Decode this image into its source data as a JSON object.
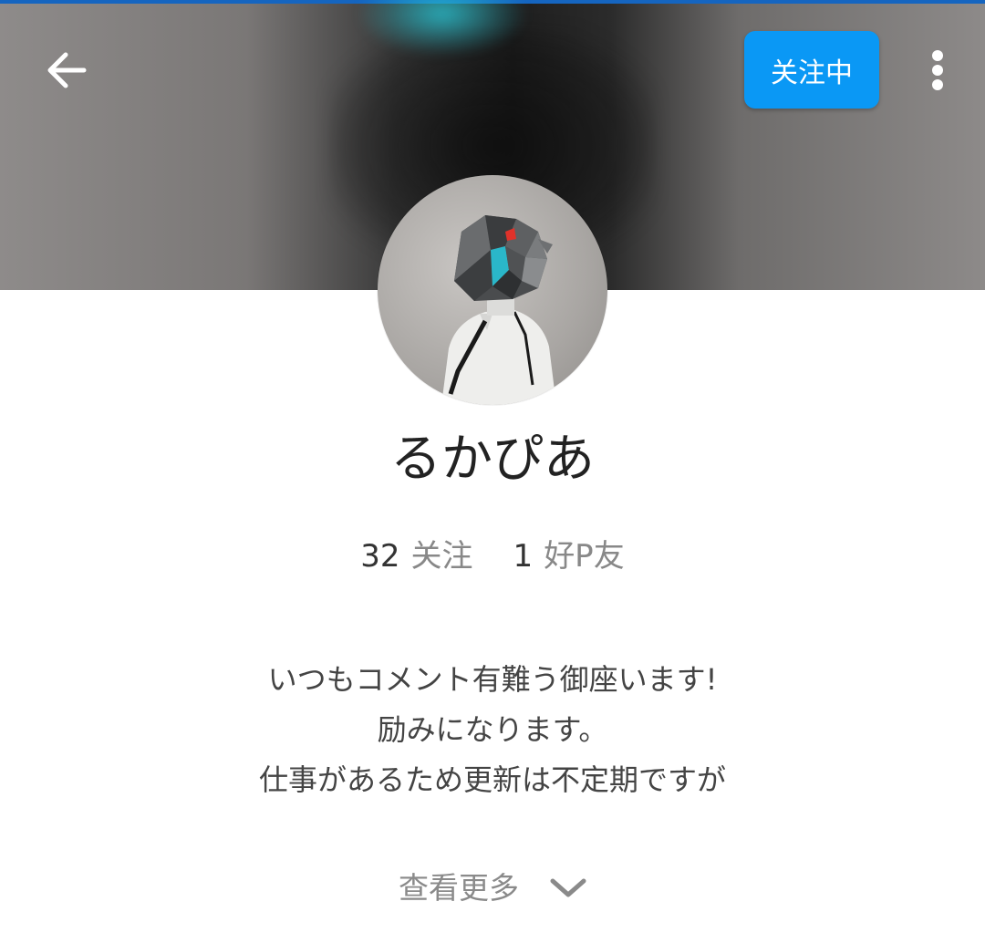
{
  "header": {
    "back_icon": "arrow-left-icon",
    "follow_button_label": "关注中",
    "more_icon": "more-vertical-icon",
    "accent_color": "#0a98f5"
  },
  "profile": {
    "username": "るかぴあ",
    "stats": [
      {
        "count": "32",
        "label": "关注"
      },
      {
        "count": "1",
        "label": "好P友"
      }
    ],
    "bio_lines": [
      "いつもコメント有難う御座います!",
      "励みになります。",
      "仕事があるため更新は不定期ですが"
    ],
    "see_more_label": "查看更多",
    "see_more_icon": "chevron-down-icon"
  }
}
